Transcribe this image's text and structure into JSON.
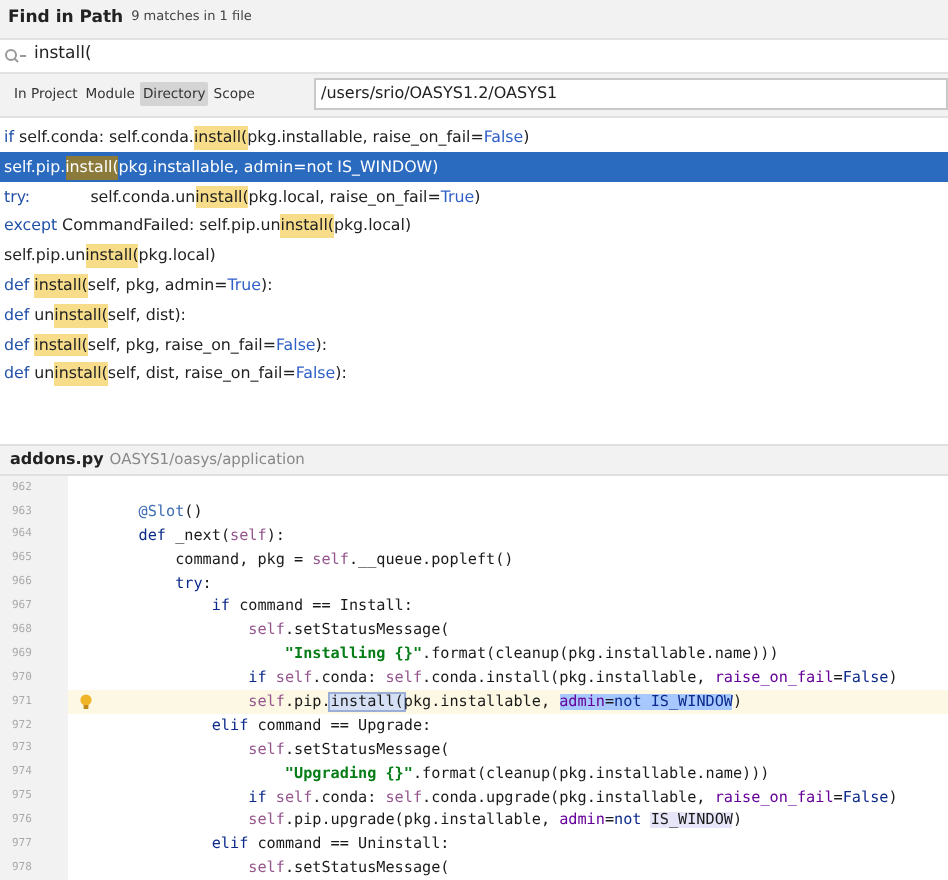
{
  "dialog": {
    "title": "Find in Path",
    "match_count": "9 matches in 1 file"
  },
  "search": {
    "value": "install("
  },
  "scopes": [
    {
      "label": "In Project",
      "selected": false
    },
    {
      "label": "Module",
      "selected": false
    },
    {
      "label": "Directory",
      "selected": true
    },
    {
      "label": "Scope",
      "selected": false
    }
  ],
  "directory": {
    "value": "/users/srio/OASYS1.2/OASYS1"
  },
  "results": [
    {
      "selected": false,
      "segments": [
        {
          "kind": "kw",
          "text": "if"
        },
        {
          "kind": "plain",
          "text": " self.conda: self.conda."
        },
        {
          "kind": "match",
          "text": "install("
        },
        {
          "kind": "plain",
          "text": "pkg.installable, raise_on_fail="
        },
        {
          "kind": "const",
          "text": "False"
        },
        {
          "kind": "plain",
          "text": ")"
        }
      ]
    },
    {
      "selected": true,
      "segments": [
        {
          "kind": "plain",
          "text": "self.pip."
        },
        {
          "kind": "match",
          "text": "install("
        },
        {
          "kind": "plain",
          "text": "pkg.installable, admin=not IS_WINDOW)"
        }
      ]
    },
    {
      "selected": false,
      "segments": [
        {
          "kind": "kw",
          "text": "try:"
        },
        {
          "kind": "plain",
          "text": "            self.conda.un"
        },
        {
          "kind": "match",
          "text": "install("
        },
        {
          "kind": "plain",
          "text": "pkg.local, raise_on_fail="
        },
        {
          "kind": "const",
          "text": "True"
        },
        {
          "kind": "plain",
          "text": ")"
        }
      ]
    },
    {
      "selected": false,
      "segments": [
        {
          "kind": "kw",
          "text": "except"
        },
        {
          "kind": "plain",
          "text": " CommandFailed: self.pip.un"
        },
        {
          "kind": "match",
          "text": "install("
        },
        {
          "kind": "plain",
          "text": "pkg.local)"
        }
      ]
    },
    {
      "selected": false,
      "segments": [
        {
          "kind": "plain",
          "text": "self.pip.un"
        },
        {
          "kind": "match",
          "text": "install("
        },
        {
          "kind": "plain",
          "text": "pkg.local)"
        }
      ]
    },
    {
      "selected": false,
      "segments": [
        {
          "kind": "kw",
          "text": "def "
        },
        {
          "kind": "match",
          "text": "install("
        },
        {
          "kind": "plain",
          "text": "self, pkg, admin="
        },
        {
          "kind": "const",
          "text": "True"
        },
        {
          "kind": "plain",
          "text": "):"
        }
      ]
    },
    {
      "selected": false,
      "segments": [
        {
          "kind": "kw",
          "text": "def"
        },
        {
          "kind": "plain",
          "text": " un"
        },
        {
          "kind": "match",
          "text": "install("
        },
        {
          "kind": "plain",
          "text": "self, dist):"
        }
      ]
    },
    {
      "selected": false,
      "segments": [
        {
          "kind": "kw",
          "text": "def "
        },
        {
          "kind": "match",
          "text": "install("
        },
        {
          "kind": "plain",
          "text": "self, pkg, raise_on_fail="
        },
        {
          "kind": "const",
          "text": "False"
        },
        {
          "kind": "plain",
          "text": "):"
        }
      ]
    },
    {
      "selected": false,
      "segments": [
        {
          "kind": "kw",
          "text": "def"
        },
        {
          "kind": "plain",
          "text": " un"
        },
        {
          "kind": "match",
          "text": "install("
        },
        {
          "kind": "plain",
          "text": "self, dist, raise_on_fail="
        },
        {
          "kind": "const",
          "text": "False"
        },
        {
          "kind": "plain",
          "text": "):"
        }
      ]
    }
  ],
  "preview": {
    "file_name": "addons.py",
    "path": "OASYS1/oasys/application",
    "lines": [
      {
        "number": "962",
        "current": false,
        "bulb": false
      },
      {
        "number": "963",
        "current": false,
        "bulb": false,
        "segments": [
          {
            "kind": "deco",
            "text": "    @Slot"
          },
          {
            "kind": "plain",
            "text": "()"
          }
        ]
      },
      {
        "number": "964",
        "current": false,
        "bulb": false,
        "segments": [
          {
            "kind": "kw",
            "text": "    def"
          },
          {
            "kind": "plain",
            "text": " _next("
          },
          {
            "kind": "self",
            "text": "self"
          },
          {
            "kind": "plain",
            "text": "):"
          }
        ]
      },
      {
        "number": "965",
        "current": false,
        "bulb": false,
        "segments": [
          {
            "kind": "plain",
            "text": "        command, pkg = "
          },
          {
            "kind": "self",
            "text": "self"
          },
          {
            "kind": "plain",
            "text": ".__queue.popleft()"
          }
        ]
      },
      {
        "number": "966",
        "current": false,
        "bulb": false,
        "segments": [
          {
            "kind": "kw",
            "text": "        try"
          },
          {
            "kind": "plain",
            "text": ":"
          }
        ]
      },
      {
        "number": "967",
        "current": false,
        "bulb": false,
        "segments": [
          {
            "kind": "kw",
            "text": "            if"
          },
          {
            "kind": "plain",
            "text": " command == Install:"
          }
        ]
      },
      {
        "number": "968",
        "current": false,
        "bulb": false,
        "segments": [
          {
            "kind": "self",
            "text": "                self"
          },
          {
            "kind": "plain",
            "text": ".setStatusMessage("
          }
        ]
      },
      {
        "number": "969",
        "current": false,
        "bulb": false,
        "segments": [
          {
            "kind": "str",
            "text": "                    \"Installing {}\""
          },
          {
            "kind": "plain",
            "text": ".format(cleanup(pkg.installable.name)))"
          }
        ]
      },
      {
        "number": "970",
        "current": false,
        "bulb": false,
        "segments": [
          {
            "kind": "kw",
            "text": "                if"
          },
          {
            "kind": "self",
            "text": " self"
          },
          {
            "kind": "plain",
            "text": ".conda: "
          },
          {
            "kind": "self",
            "text": "self"
          },
          {
            "kind": "plain",
            "text": ".conda.install(pkg.installable, "
          },
          {
            "kind": "named",
            "text": "raise_on_fail"
          },
          {
            "kind": "plain",
            "text": "="
          },
          {
            "kind": "kw",
            "text": "False"
          },
          {
            "kind": "plain",
            "text": ")"
          }
        ]
      },
      {
        "number": "971",
        "current": true,
        "bulb": true,
        "segments": [
          {
            "kind": "self",
            "text": "                self"
          },
          {
            "kind": "plain",
            "text": ".pip."
          },
          {
            "kind": "plain",
            "text": "install(",
            "search_hit": true
          },
          {
            "kind": "plain",
            "text": "pkg.installable, "
          },
          {
            "kind": "named",
            "text": "admin",
            "in_selection": true
          },
          {
            "kind": "plain",
            "text": "=",
            "in_selection": true
          },
          {
            "kind": "kw",
            "text": "not IS_WINDOW",
            "in_selection": true
          },
          {
            "kind": "plain",
            "text": ")"
          }
        ]
      },
      {
        "number": "972",
        "current": false,
        "bulb": false,
        "segments": [
          {
            "kind": "kw",
            "text": "            elif"
          },
          {
            "kind": "plain",
            "text": " command == Upgrade:"
          }
        ]
      },
      {
        "number": "973",
        "current": false,
        "bulb": false,
        "segments": [
          {
            "kind": "self",
            "text": "                self"
          },
          {
            "kind": "plain",
            "text": ".setStatusMessage("
          }
        ]
      },
      {
        "number": "974",
        "current": false,
        "bulb": false,
        "segments": [
          {
            "kind": "str",
            "text": "                    \"Upgrading {}\""
          },
          {
            "kind": "plain",
            "text": ".format(cleanup(pkg.installable.name)))"
          }
        ]
      },
      {
        "number": "975",
        "current": false,
        "bulb": false,
        "segments": [
          {
            "kind": "kw",
            "text": "                if"
          },
          {
            "kind": "self",
            "text": " self"
          },
          {
            "kind": "plain",
            "text": ".conda: "
          },
          {
            "kind": "self",
            "text": "self"
          },
          {
            "kind": "plain",
            "text": ".conda.upgrade(pkg.installable, "
          },
          {
            "kind": "named",
            "text": "raise_on_fail"
          },
          {
            "kind": "plain",
            "text": "="
          },
          {
            "kind": "kw",
            "text": "False"
          },
          {
            "kind": "plain",
            "text": ")"
          }
        ]
      },
      {
        "number": "976",
        "current": false,
        "bulb": false,
        "segments": [
          {
            "kind": "self",
            "text": "                self"
          },
          {
            "kind": "plain",
            "text": ".pip.upgrade(pkg.installable, "
          },
          {
            "kind": "named",
            "text": "admin"
          },
          {
            "kind": "plain",
            "text": "="
          },
          {
            "kind": "kw",
            "text": "not "
          },
          {
            "kind": "plain",
            "text": "IS_WINDOW",
            "usage_hit": true
          },
          {
            "kind": "plain",
            "text": ")"
          }
        ]
      },
      {
        "number": "977",
        "current": false,
        "bulb": false,
        "segments": [
          {
            "kind": "kw",
            "text": "            elif"
          },
          {
            "kind": "plain",
            "text": " command == Uninstall:"
          }
        ]
      },
      {
        "number": "978",
        "current": false,
        "bulb": false,
        "segments": [
          {
            "kind": "self",
            "text": "                self"
          },
          {
            "kind": "plain",
            "text": ".setStatusMessage("
          }
        ]
      }
    ]
  }
}
